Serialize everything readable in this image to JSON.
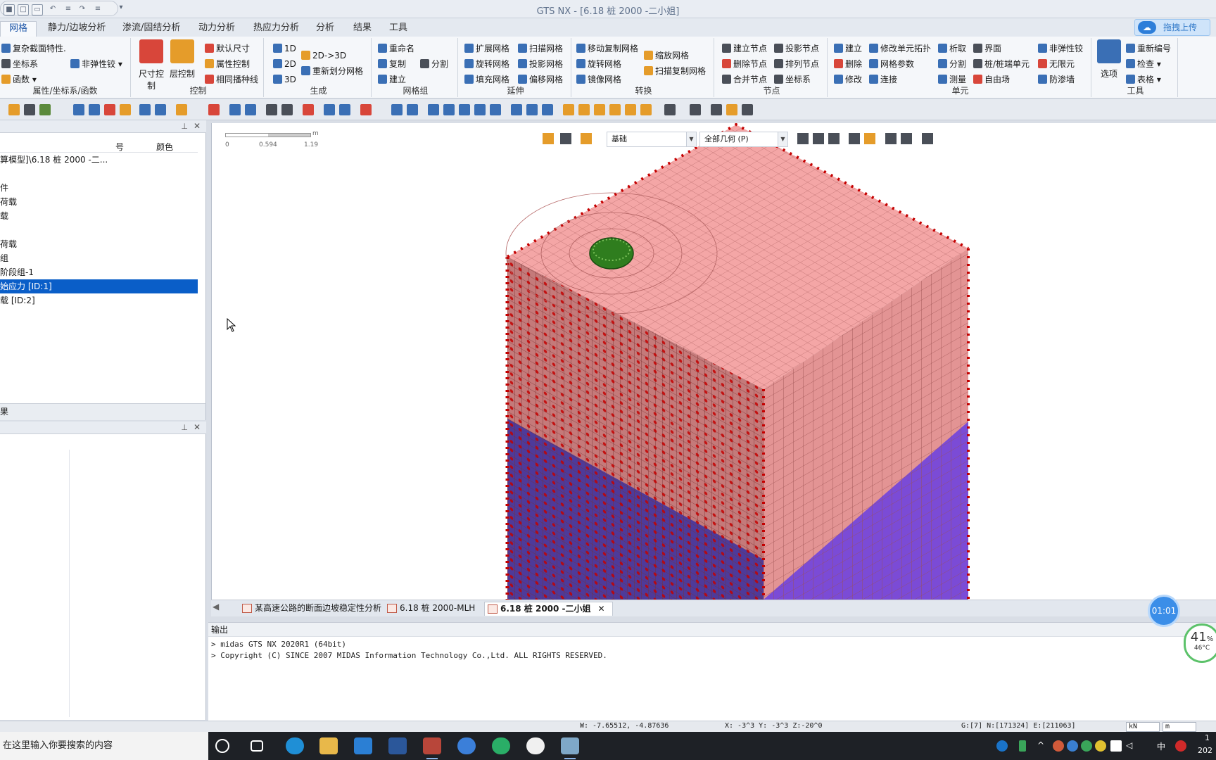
{
  "window": {
    "title": "GTS NX - [6.18 桩 2000 -二小姐]"
  },
  "menu_tabs": [
    {
      "label": "网格"
    },
    {
      "label": "静力/边坡分析"
    },
    {
      "label": "渗流/固结分析"
    },
    {
      "label": "动力分析"
    },
    {
      "label": "热应力分析"
    },
    {
      "label": "分析"
    },
    {
      "label": "结果"
    },
    {
      "label": "工具"
    }
  ],
  "upload_button": "拖拽上传",
  "ribbon": {
    "attr": {
      "items": [
        "复杂截面特性.",
        "坐标系",
        "函数 ▾",
        "非弹性铰 ▾"
      ],
      "label": "属性/坐标系/函数"
    },
    "control": {
      "big1": "尺寸控制",
      "big2": "层控制",
      "items": [
        "默认尺寸",
        "属性控制",
        "相同播种线"
      ],
      "label": "控制"
    },
    "generate": {
      "items": [
        "1D",
        "2D",
        "3D",
        "2D->3D",
        "重新划分网格"
      ],
      "label": "生成"
    },
    "mesh_group": {
      "items": [
        "重命名",
        "复制",
        "分割",
        "建立"
      ],
      "label": "网格组"
    },
    "extend": {
      "items": [
        "扩展网格",
        "旋转网格",
        "填充网格",
        "扫描网格",
        "投影网格",
        "偏移网格"
      ],
      "label": "延伸"
    },
    "transform": {
      "items": [
        "移动复制网格",
        "旋转网格",
        "镜像网格",
        "缩放网格",
        "扫描复制网格"
      ],
      "label": "转换"
    },
    "node": {
      "items": [
        "建立节点",
        "删除节点",
        "合并节点",
        "投影节点",
        "排列节点",
        "坐标系"
      ],
      "label": "节点"
    },
    "element": {
      "items": [
        "建立",
        "删除",
        "修改",
        "修改单元拓扑",
        "网格参数",
        "连接",
        "析取",
        "分割",
        "测量",
        "界面",
        "桩/桩端单元",
        "自由场",
        "非弹性铰",
        "无限元",
        "防渗墙"
      ],
      "label": "单元"
    },
    "tools": {
      "big": "选项",
      "items": [
        "重新编号",
        "检查 ▾",
        "表格 ▾"
      ],
      "label": "工具"
    }
  },
  "left_panel": {
    "columns": [
      "号",
      "颜色"
    ],
    "rows": [
      "算模型]\\6.18 桩 2000 -二...",
      "",
      "件",
      "荷载",
      "载",
      "",
      "荷载",
      "组",
      "阶段组-1",
      "始应力 [ID:1]",
      "载 [ID:2]"
    ],
    "selected_index": 9,
    "footer": "果"
  },
  "viewport": {
    "scale_labels": [
      "0",
      "0.594",
      "1.19"
    ],
    "scale_unit": "m",
    "select1": "基础",
    "select2": "全部几何 (P)"
  },
  "doc_tabs": [
    "某高速公路的断面边坡稳定性分析",
    "6.18 桩 2000-MLH",
    "6.18 桩 2000 -二小姐"
  ],
  "output": {
    "title": "输出",
    "lines": [
      "> midas GTS NX 2020R1 (64bit)",
      "> Copyright (C) SINCE 2007 MIDAS Information Technology Co.,Ltd. ALL RIGHTS RESERVED."
    ]
  },
  "status": {
    "w": "W: -7.65512, -4.87636",
    "xyz": "X: -3^3 Y: -3^3 Z:-20^0",
    "counts": "G:[7] N:[171324] E:[211063]",
    "unit1": "kN",
    "unit2": "m"
  },
  "taskbar": {
    "search_placeholder": "在这里输入你要搜索的内容",
    "ime": "中",
    "clock_top": "1",
    "clock_bottom": "202"
  },
  "widgets": {
    "timer": "01:01",
    "cpu_percent": "41",
    "cpu_unit": "%",
    "cpu_temp": "46°C"
  },
  "colors": {
    "accent": "#0a5ec8",
    "mesh_top": "#f4a6a6",
    "mesh_side": "#e39090",
    "soil_lower": "#7b4bd6",
    "constraint": "#d00000"
  }
}
